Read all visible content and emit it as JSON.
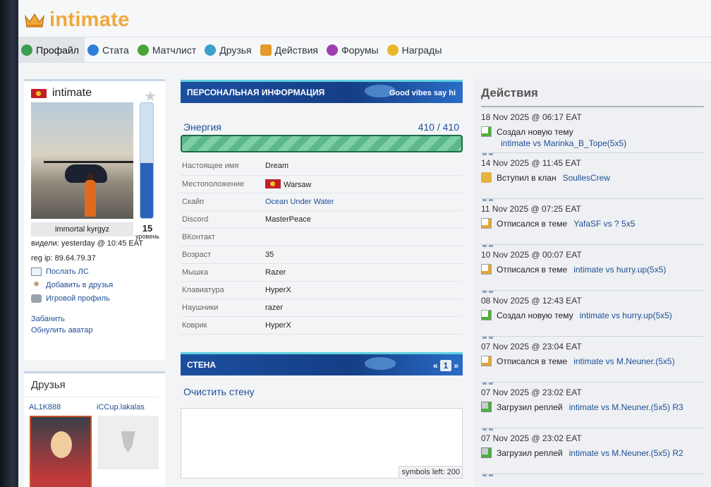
{
  "logo": {
    "text": "intimate",
    "accent": "#f0a83c"
  },
  "nav": [
    {
      "label": "Профайл",
      "icon": "profile-icon",
      "active": true,
      "color": "#3a9d4f"
    },
    {
      "label": "Стата",
      "icon": "stats-icon",
      "color": "#2f7fd6"
    },
    {
      "label": "Матчлист",
      "icon": "matchlist-icon",
      "color": "#49a634"
    },
    {
      "label": "Друзья",
      "icon": "friends-icon",
      "color": "#3aa0c9"
    },
    {
      "label": "Действия",
      "icon": "actions-icon",
      "color": "#e29a2a"
    },
    {
      "label": "Форумы",
      "icon": "forums-icon",
      "color": "#9b3fb0"
    },
    {
      "label": "Награды",
      "icon": "awards-icon",
      "color": "#e8b82a"
    }
  ],
  "profile": {
    "name": "intimate",
    "avatar_caption": "immortal kyrgyz",
    "level": "15",
    "level_label": "уровень",
    "level_fraction": 0.48,
    "seen": "видели: yesterday @ 10:45 EAT",
    "reg_ip": "reg ip: 89.64.79.37",
    "actions": [
      "Послать ЛС",
      "Добавить в друзья",
      "Игровой профиль"
    ],
    "ban": "Забанить",
    "reset_avatar": "Обнулить аватар"
  },
  "friends": {
    "title": "Друзья",
    "names": [
      "AL1K888",
      "iCCup.lakalas"
    ]
  },
  "personal": {
    "title": "ПЕРСОНАЛЬНАЯ ИНФОРМАЦИЯ",
    "status": "Good vibes say hi",
    "energy_label": "Энергия",
    "energy_value": "410 / 410",
    "rows": [
      {
        "key": "Настоящее имя",
        "value": "Dream"
      },
      {
        "key": "Местоположение",
        "value": "Warsaw",
        "flag": true
      },
      {
        "key": "Скайп",
        "value": "Ocean Under Water",
        "link": true
      },
      {
        "key": "Discord",
        "value": "MasterPeace"
      },
      {
        "key": "ВКонтакт",
        "value": ""
      },
      {
        "key": "Возраст",
        "value": "35"
      },
      {
        "key": "Мышка",
        "value": "Razer"
      },
      {
        "key": "Клавиатура",
        "value": "HyperX"
      },
      {
        "key": "Наушники",
        "value": "razer"
      },
      {
        "key": "Коврик",
        "value": "HyperX"
      }
    ]
  },
  "wall": {
    "title": "СТЕНА",
    "page_prev": "«",
    "page": "1",
    "page_next": "»",
    "clear": "Очистить стену",
    "symbols_left": "symbols left: 200"
  },
  "activity": {
    "title": "Действия",
    "items": [
      {
        "time": "18 Nov 2025 @ 06:17 EAT",
        "text": "Создал новую тему",
        "link": "",
        "sub": "intimate vs Marinka_B_Tope(5x5)",
        "icon": "new-topic-icon"
      },
      {
        "time": "14 Nov 2025 @ 11:45 EAT",
        "text": "Вступил в клан",
        "link": "SoullesCrew",
        "sub": "",
        "icon": "clan-icon"
      },
      {
        "time": "11 Nov 2025 @ 07:25 EAT",
        "text": "Отписался в теме",
        "link": "YafaSF vs ? 5x5",
        "sub": "",
        "icon": "post-icon"
      },
      {
        "time": "10 Nov 2025 @ 00:07 EAT",
        "text": "Отписался в теме",
        "link": "intimate vs hurry.up(5x5)",
        "sub": "",
        "icon": "post-icon"
      },
      {
        "time": "08 Nov 2025 @ 12:43 EAT",
        "text": "Создал новую тему",
        "link": "intimate vs hurry.up(5x5)",
        "sub": "",
        "icon": "new-topic-icon"
      },
      {
        "time": "07 Nov 2025 @ 23:04 EAT",
        "text": "Отписался в теме",
        "link": "intimate vs M.Neuner.(5x5)",
        "sub": "",
        "icon": "post-icon"
      },
      {
        "time": "07 Nov 2025 @ 23:02 EAT",
        "text": "Загрузил реплей",
        "link": "intimate vs M.Neuner.(5x5) R3",
        "sub": "",
        "icon": "replay-icon"
      },
      {
        "time": "07 Nov 2025 @ 23:02 EAT",
        "text": "Загрузил реплей",
        "link": "intimate vs M.Neuner.(5x5) R2",
        "sub": "",
        "icon": "replay-icon"
      }
    ]
  }
}
